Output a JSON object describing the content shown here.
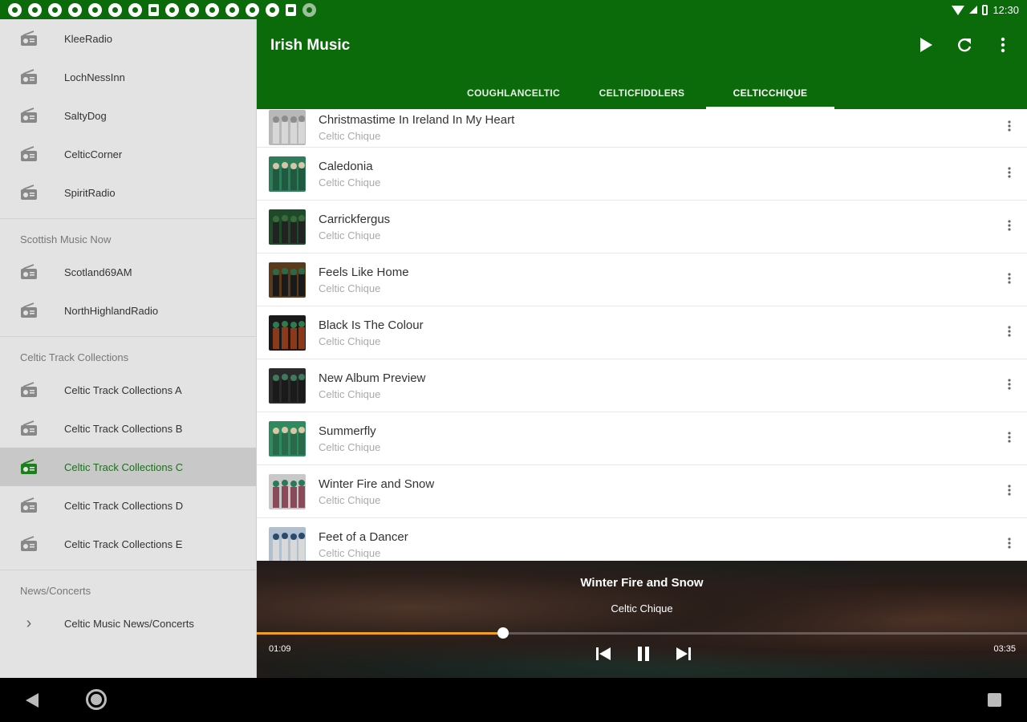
{
  "status_bar": {
    "time": "12:30",
    "notification_icons": [
      "circle",
      "circle",
      "circle",
      "circle",
      "gear",
      "bell",
      "bell",
      "square",
      "circle",
      "circle",
      "circle",
      "circle",
      "circle",
      "circle",
      "sd-card",
      "grey-circle"
    ]
  },
  "drawer": {
    "section_1_items": [
      {
        "label": "KleeRadio",
        "icon": "radio-icon"
      },
      {
        "label": "LochNessInn",
        "icon": "radio-icon"
      },
      {
        "label": "SaltyDog",
        "icon": "radio-icon"
      },
      {
        "label": "CelticCorner",
        "icon": "radio-icon"
      },
      {
        "label": "SpiritRadio",
        "icon": "radio-icon"
      }
    ],
    "section_2_header": "Scottish Music Now",
    "section_2_items": [
      {
        "label": "Scotland69AM",
        "icon": "radio-icon"
      },
      {
        "label": "NorthHighlandRadio",
        "icon": "radio-icon"
      }
    ],
    "section_3_header": "Celtic Track Collections",
    "section_3_items": [
      {
        "label": "Celtic Track Collections A",
        "icon": "radio-icon"
      },
      {
        "label": "Celtic Track Collections B",
        "icon": "radio-icon"
      },
      {
        "label": "Celtic Track Collections C",
        "icon": "radio-icon",
        "active": true
      },
      {
        "label": "Celtic Track Collections D",
        "icon": "radio-icon"
      },
      {
        "label": "Celtic Track Collections E",
        "icon": "radio-icon"
      }
    ],
    "section_4_header": "News/Concerts",
    "section_4_items": [
      {
        "label": "Celtic Music News/Concerts",
        "icon": "chevron-right-icon"
      }
    ]
  },
  "appbar": {
    "title": "Irish Music",
    "actions": [
      "play-icon",
      "refresh-icon",
      "more-vert-icon"
    ],
    "tabs": [
      {
        "label": "COUGHLANCELTIC",
        "active": false
      },
      {
        "label": "CELTICFIDDLERS",
        "active": false
      },
      {
        "label": "CELTICCHIQUE",
        "active": true
      }
    ]
  },
  "tracks": [
    {
      "title": "Christmastime In Ireland In My Heart",
      "artist": "Celtic Chique"
    },
    {
      "title": "Caledonia",
      "artist": "Celtic Chique"
    },
    {
      "title": "Carrickfergus",
      "artist": "Celtic Chique"
    },
    {
      "title": "Feels Like Home",
      "artist": "Celtic Chique"
    },
    {
      "title": "Black Is The Colour",
      "artist": "Celtic Chique"
    },
    {
      "title": "New Album Preview",
      "artist": "Celtic Chique"
    },
    {
      "title": "Summerfly",
      "artist": "Celtic Chique"
    },
    {
      "title": "Winter Fire and Snow",
      "artist": "Celtic Chique"
    },
    {
      "title": "Feet of a Dancer",
      "artist": "Celtic Chique"
    }
  ],
  "player": {
    "title": "Winter Fire and Snow",
    "artist": "Celtic Chique",
    "current_time": "01:09",
    "duration": "03:35",
    "progress_fraction": 0.32,
    "accent": "#f0a020"
  },
  "colors": {
    "primary": "#0b6b0b",
    "drawer_bg": "#e3e3e3",
    "active_text": "#1e6e1e"
  }
}
